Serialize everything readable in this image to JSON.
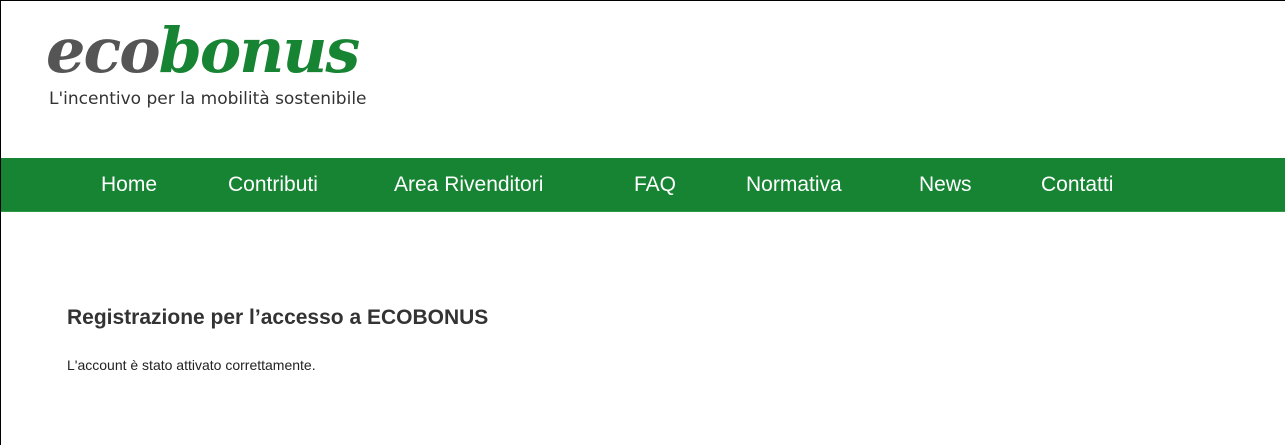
{
  "header": {
    "logo": {
      "part1": "eco",
      "part2": "bonus",
      "tagline": "L'incentivo per la mobilità sostenibile"
    }
  },
  "nav": {
    "items": [
      {
        "label": "Home"
      },
      {
        "label": "Contributi"
      },
      {
        "label": "Area Rivenditori"
      },
      {
        "label": "FAQ"
      },
      {
        "label": "Normativa"
      },
      {
        "label": "News"
      },
      {
        "label": "Contatti"
      }
    ]
  },
  "main": {
    "title": "Registrazione per l’accesso a ECOBONUS",
    "message": "L'account è stato attivato correttamente."
  },
  "colors": {
    "brand_green": "#178434",
    "logo_gray": "#555555",
    "text_dark": "#333333"
  }
}
